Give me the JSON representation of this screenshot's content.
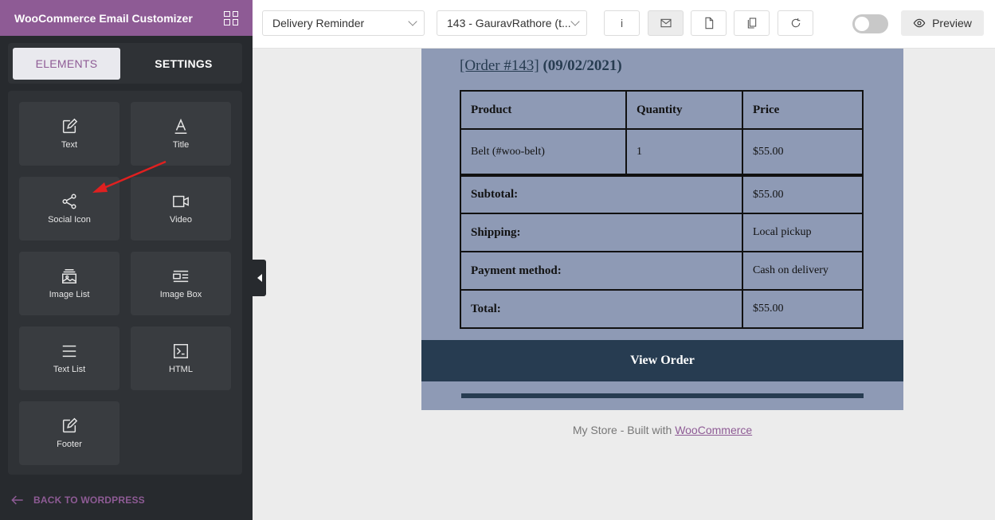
{
  "sidebar": {
    "title": "WooCommerce Email Customizer",
    "tabs": {
      "elements": "ELEMENTS",
      "settings": "SETTINGS"
    },
    "elements": [
      {
        "label": "Text",
        "icon": "edit-icon"
      },
      {
        "label": "Title",
        "icon": "title-icon"
      },
      {
        "label": "Social Icon",
        "icon": "share-icon"
      },
      {
        "label": "Video",
        "icon": "video-icon"
      },
      {
        "label": "Image List",
        "icon": "image-list-icon"
      },
      {
        "label": "Image Box",
        "icon": "image-box-icon"
      },
      {
        "label": "Text List",
        "icon": "list-icon"
      },
      {
        "label": "HTML",
        "icon": "terminal-icon"
      },
      {
        "label": "Footer",
        "icon": "edit-icon"
      }
    ],
    "back_label": "BACK TO WORDPRESS"
  },
  "toolbar": {
    "template_select": "Delivery Reminder",
    "order_select": "143 - GauravRathore (t...",
    "info_label": "i",
    "preview_label": "Preview"
  },
  "email": {
    "order_link": "[Order #143]",
    "order_date": "(09/02/2021)",
    "table": {
      "headers": [
        "Product",
        "Quantity",
        "Price"
      ],
      "item": {
        "product": "Belt (#woo-belt)",
        "quantity": "1",
        "price": "$55.00"
      },
      "summary": [
        {
          "label": "Subtotal:",
          "value": "$55.00"
        },
        {
          "label": "Shipping:",
          "value": "Local pickup"
        },
        {
          "label": "Payment method:",
          "value": "Cash on delivery"
        },
        {
          "label": "Total:",
          "value": "$55.00"
        }
      ]
    },
    "button": "View Order"
  },
  "footer": {
    "prefix": "My Store - Built with ",
    "link": "WooCommerce"
  },
  "colors": {
    "brand": "#8e5b95",
    "sidebar": "#272a2e",
    "email_bg": "#8e9ab5",
    "email_dark": "#273c51",
    "annotation": "#e02020"
  }
}
